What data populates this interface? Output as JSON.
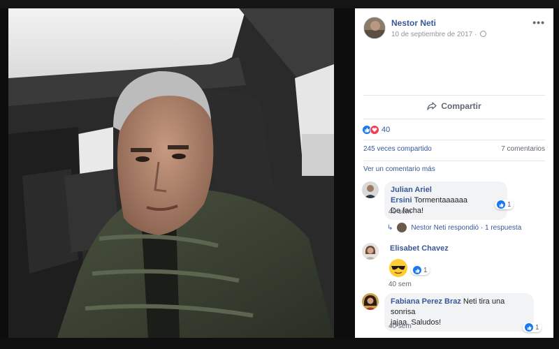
{
  "post": {
    "author": "Nestor Neti",
    "date": "10 de septiembre de 2017",
    "date_separator": "·",
    "more_menu": "•••",
    "share_label": "Compartir",
    "reactions_count": "40",
    "shares_text": "245 veces compartido",
    "comments_text": "7 comentarios",
    "view_more_comments": "Ver un comentario más"
  },
  "comments": [
    {
      "name": "Julian Ariel Ersini",
      "text_line1": "Tormentaaaaaa",
      "text_line2": "De facha!",
      "time": "40 sem",
      "likes": "1",
      "reply": {
        "author": "Nestor Neti",
        "action": "respondió",
        "separator": "·",
        "count_text": "1 respuesta"
      }
    },
    {
      "name": "Elisabet Chavez",
      "emoji": "sunglasses-emoji",
      "time": "40 sem",
      "likes": "1"
    },
    {
      "name": "Fabiana Perez Braz",
      "text_line1": "Neti tira una sonrisa",
      "text_line2": "jajaa. Saludos!",
      "time": "40 sem",
      "likes": "1"
    }
  ],
  "icons": {
    "share": "share-arrow-icon",
    "globe": "globe-icon",
    "like": "like-reaction-icon",
    "love": "love-reaction-icon"
  },
  "colors": {
    "link": "#365899",
    "like": "#1877f2",
    "love": "#f33e58",
    "bubble": "#f2f3f5"
  }
}
